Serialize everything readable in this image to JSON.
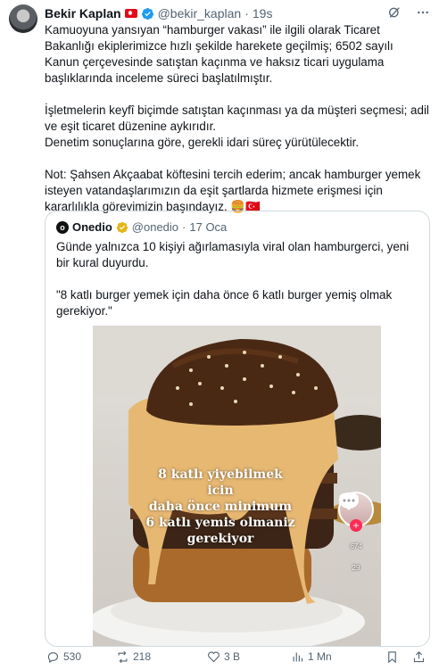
{
  "tweet": {
    "author_name": "Bekir Kaplan",
    "handle": "@bekir_kaplan",
    "separator": "·",
    "time": "19s",
    "body": [
      "Kamuoyuna yansıyan “hamburger vakası” ile ilgili olarak Ticaret Bakanlığı ekiplerimizce hızlı şekilde harekete geçilmiş; 6502 sayılı Kanun çerçevesinde satıştan kaçınma ve haksız ticari uygulama başlıklarında inceleme süreci başlatılmıştır.",
      "İşletmelerin keyfî biçimde satıştan kaçınması ya da müşteri seçmesi; adil ve eşit ticaret düzenine aykırıdır.",
      "Denetim sonuçlarına göre, gerekli idari süreç yürütülecektir.",
      "Not: Şahsen Akçaabat köftesini tercih ederim; ancak hamburger yemek isteyen vatandaşlarımızın da eşit şartlarda hizmete erişmesi için kararlılıkla görevimizin başındayız. 🍔🇹🇷"
    ]
  },
  "quote": {
    "author_name": "Onedio",
    "handle": "@onedio",
    "separator": "·",
    "time": "17 Oca",
    "text1": "Günde yalnızca 10 kişiyi ağırlamasıyla viral olan hamburgerci, yeni bir kural duyurdu.",
    "text2": "\"8 katlı burger yemek için daha önce 6 katlı burger yemiş olmak gerekiyor.\"",
    "media": {
      "overlay_lines": [
        "8 katlı yiyebilmek icin",
        "daha önce minimum",
        "6 katlı yemis olmaniz",
        "gerekiyor"
      ],
      "likes": "674",
      "comments": "29"
    }
  },
  "actions": {
    "replies": "530",
    "reposts": "218",
    "likes": "3 B",
    "views": "1 Mn"
  },
  "colors": {
    "verified": "#1d9bf0",
    "gold": "#e2b719",
    "muted": "#536471",
    "border": "#cfd9de"
  }
}
